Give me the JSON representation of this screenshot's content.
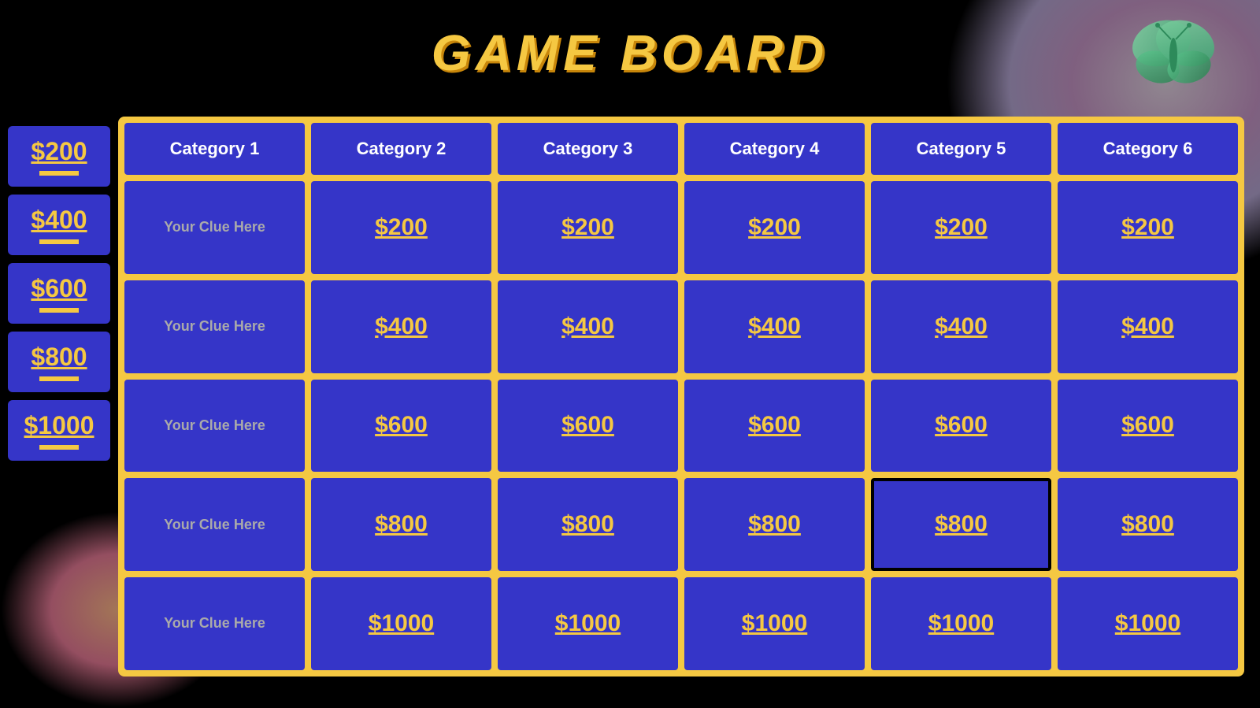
{
  "title": "GAME BOARD",
  "categories": [
    "Category 1",
    "Category 2",
    "Category 3",
    "Category 4",
    "Category 5",
    "Category 6"
  ],
  "scores": [
    "$200",
    "$400",
    "$600",
    "$800",
    "$1000"
  ],
  "rows": [
    {
      "cat1": "Your Clue Here",
      "values": [
        "$200",
        "$200",
        "$200",
        "$200",
        "$200"
      ]
    },
    {
      "cat1": "Your Clue Here",
      "values": [
        "$400",
        "$400",
        "$400",
        "$400",
        "$400"
      ]
    },
    {
      "cat1": "Your Clue Here",
      "values": [
        "$600",
        "$600",
        "$600",
        "$600",
        "$600"
      ]
    },
    {
      "cat1": "Your Clue Here",
      "values": [
        "$800",
        "$800",
        "$800",
        "$800",
        "$800"
      ]
    },
    {
      "cat1": "Your Clue Here",
      "values": [
        "$1000",
        "$1000",
        "$1000",
        "$1000",
        "$1000"
      ]
    }
  ],
  "special_cell": {
    "row": 3,
    "col": 4,
    "label": "$800"
  }
}
